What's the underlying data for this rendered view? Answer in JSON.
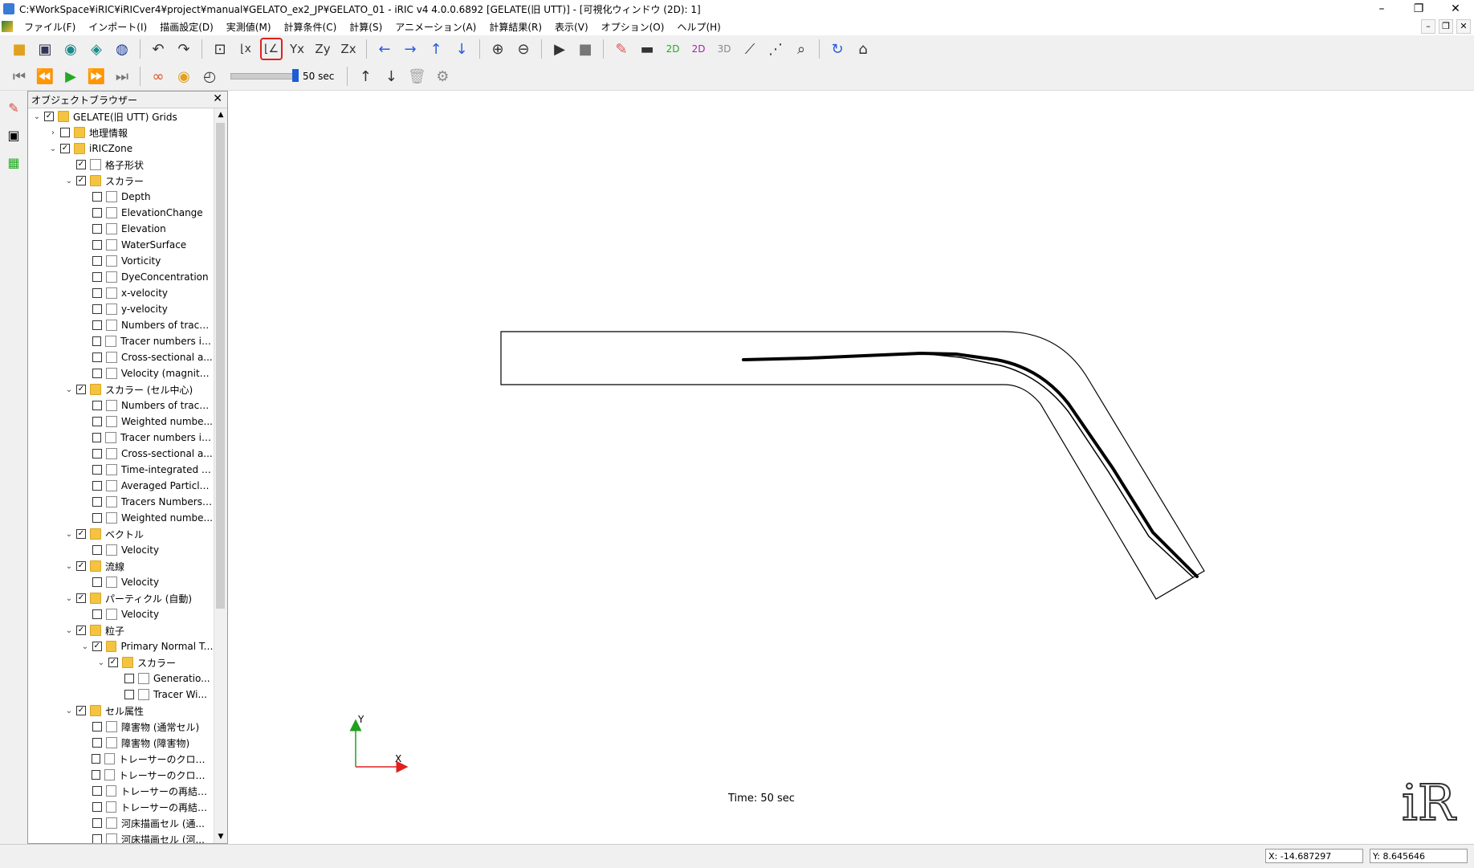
{
  "window": {
    "title": "C:¥WorkSpace¥iRIC¥iRICver4¥project¥manual¥GELATO_ex2_JP¥GELATO_01 - iRIC v4 4.0.0.6892 [GELATE(旧 UTT)] - [可視化ウィンドウ (2D): 1]"
  },
  "menu": [
    "ファイル(F)",
    "インポート(I)",
    "描画設定(D)",
    "実測値(M)",
    "計算条件(C)",
    "計算(S)",
    "アニメーション(A)",
    "計算結果(R)",
    "表示(V)",
    "オプション(O)",
    "ヘルプ(H)"
  ],
  "animation": {
    "time_label": "50 sec"
  },
  "browser": {
    "title": "オブジェクトブラウザー",
    "items": [
      {
        "label": "GELATE(旧 UTT) Grids",
        "level": 0,
        "arrow": "v",
        "checked": true,
        "icon": "folder"
      },
      {
        "label": "地理情報",
        "level": 1,
        "arrow": ">",
        "checked": false,
        "icon": "folder"
      },
      {
        "label": "iRICZone",
        "level": 1,
        "arrow": "v",
        "checked": true,
        "icon": "folder"
      },
      {
        "label": "格子形状",
        "level": 2,
        "arrow": "",
        "checked": true,
        "icon": "doc"
      },
      {
        "label": "スカラー",
        "level": 2,
        "arrow": "v",
        "checked": true,
        "icon": "folder"
      },
      {
        "label": "Depth",
        "level": 3,
        "arrow": "",
        "checked": false,
        "icon": "doc"
      },
      {
        "label": "ElevationChange",
        "level": 3,
        "arrow": "",
        "checked": false,
        "icon": "doc"
      },
      {
        "label": "Elevation",
        "level": 3,
        "arrow": "",
        "checked": false,
        "icon": "doc"
      },
      {
        "label": "WaterSurface",
        "level": 3,
        "arrow": "",
        "checked": false,
        "icon": "doc"
      },
      {
        "label": "Vorticity",
        "level": 3,
        "arrow": "",
        "checked": false,
        "icon": "doc"
      },
      {
        "label": "DyeConcentration",
        "level": 3,
        "arrow": "",
        "checked": false,
        "icon": "doc"
      },
      {
        "label": "x-velocity",
        "level": 3,
        "arrow": "",
        "checked": false,
        "icon": "doc"
      },
      {
        "label": "y-velocity",
        "level": 3,
        "arrow": "",
        "checked": false,
        "icon": "doc"
      },
      {
        "label": "Numbers of trace...",
        "level": 3,
        "arrow": "",
        "checked": false,
        "icon": "doc"
      },
      {
        "label": "Tracer numbers in...",
        "level": 3,
        "arrow": "",
        "checked": false,
        "icon": "doc"
      },
      {
        "label": "Cross-sectional a...",
        "level": 3,
        "arrow": "",
        "checked": false,
        "icon": "doc"
      },
      {
        "label": "Velocity (magnitu...",
        "level": 3,
        "arrow": "",
        "checked": false,
        "icon": "doc"
      },
      {
        "label": "スカラー (セル中心)",
        "level": 2,
        "arrow": "v",
        "checked": true,
        "icon": "folder"
      },
      {
        "label": "Numbers of trace...",
        "level": 3,
        "arrow": "",
        "checked": false,
        "icon": "doc"
      },
      {
        "label": "Weighted numbe...",
        "level": 3,
        "arrow": "",
        "checked": false,
        "icon": "doc"
      },
      {
        "label": "Tracer numbers in...",
        "level": 3,
        "arrow": "",
        "checked": false,
        "icon": "doc"
      },
      {
        "label": "Cross-sectional a...",
        "level": 3,
        "arrow": "",
        "checked": false,
        "icon": "doc"
      },
      {
        "label": "Time-integrated P...",
        "level": 3,
        "arrow": "",
        "checked": false,
        "icon": "doc"
      },
      {
        "label": "Averaged Particle...",
        "level": 3,
        "arrow": "",
        "checked": false,
        "icon": "doc"
      },
      {
        "label": "Tracers Numbers(...",
        "level": 3,
        "arrow": "",
        "checked": false,
        "icon": "doc"
      },
      {
        "label": "Weighted numbe...",
        "level": 3,
        "arrow": "",
        "checked": false,
        "icon": "doc"
      },
      {
        "label": "ベクトル",
        "level": 2,
        "arrow": "v",
        "checked": true,
        "icon": "folder"
      },
      {
        "label": "Velocity",
        "level": 3,
        "arrow": "",
        "checked": false,
        "icon": "doc"
      },
      {
        "label": "流線",
        "level": 2,
        "arrow": "v",
        "checked": true,
        "icon": "folder"
      },
      {
        "label": "Velocity",
        "level": 3,
        "arrow": "",
        "checked": false,
        "icon": "doc"
      },
      {
        "label": "パーティクル (自動)",
        "level": 2,
        "arrow": "v",
        "checked": true,
        "icon": "folder"
      },
      {
        "label": "Velocity",
        "level": 3,
        "arrow": "",
        "checked": false,
        "icon": "doc"
      },
      {
        "label": "粒子",
        "level": 2,
        "arrow": "v",
        "checked": true,
        "icon": "folder"
      },
      {
        "label": "Primary Normal Tr...",
        "level": 3,
        "arrow": "v",
        "checked": true,
        "icon": "folder"
      },
      {
        "label": "スカラー",
        "level": 4,
        "arrow": "v",
        "checked": true,
        "icon": "folder"
      },
      {
        "label": "Generatio...",
        "level": 5,
        "arrow": "",
        "checked": false,
        "icon": "doc"
      },
      {
        "label": "Tracer Wi...",
        "level": 5,
        "arrow": "",
        "checked": false,
        "icon": "doc"
      },
      {
        "label": "セル属性",
        "level": 2,
        "arrow": "v",
        "checked": true,
        "icon": "folder"
      },
      {
        "label": "障害物 (通常セル)",
        "level": 3,
        "arrow": "",
        "checked": false,
        "icon": "doc"
      },
      {
        "label": "障害物 (障害物)",
        "level": 3,
        "arrow": "",
        "checked": false,
        "icon": "doc"
      },
      {
        "label": "トレーサーのクローニ...",
        "level": 3,
        "arrow": "",
        "checked": false,
        "icon": "doc"
      },
      {
        "label": "トレーサーのクローニ...",
        "level": 3,
        "arrow": "",
        "checked": false,
        "icon": "doc"
      },
      {
        "label": "トレーサーの再結合...",
        "level": 3,
        "arrow": "",
        "checked": false,
        "icon": "doc"
      },
      {
        "label": "トレーサーの再結合...",
        "level": 3,
        "arrow": "",
        "checked": false,
        "icon": "doc"
      },
      {
        "label": "河床描画セル (通...",
        "level": 3,
        "arrow": "",
        "checked": false,
        "icon": "doc"
      },
      {
        "label": "河床描画セル (河...",
        "level": 3,
        "arrow": "",
        "checked": false,
        "icon": "doc"
      }
    ]
  },
  "canvas": {
    "axis_y": "Y",
    "axis_x": "X",
    "time_text": "Time: 50 sec",
    "logo_text": "iR"
  },
  "status": {
    "x": "X: -14.687297",
    "y": "Y: 8.645646"
  },
  "colors": {
    "axis_x": "#e02020",
    "axis_y": "#20a020",
    "highlight": "#e02020"
  }
}
